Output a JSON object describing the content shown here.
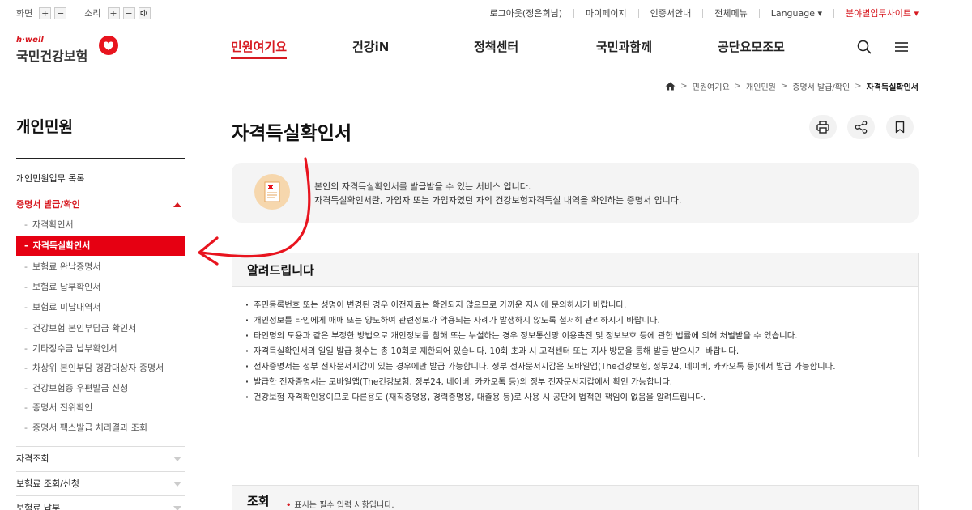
{
  "util": {
    "screen_label": "화면",
    "sound_label": "소리",
    "plus": "+",
    "minus": "−",
    "speaker": "🕩",
    "links": [
      "로그아웃(정은희님)",
      "마이페이지",
      "인증서안내",
      "전체메뉴",
      "Language ▾",
      "분야별업무사이트 ▾"
    ]
  },
  "logo": {
    "sub": "h·well",
    "main": "국민건강보험"
  },
  "nav": {
    "items": [
      "민원여기요",
      "건강iN",
      "정책센터",
      "국민과함께",
      "공단요모조모"
    ],
    "search_icon": "search-icon",
    "menu_icon": "hamburger-icon"
  },
  "breadcrumb": {
    "home_icon": "home-icon",
    "items": [
      "민원여기요",
      "개인민원",
      "증명서 발급/확인"
    ],
    "current": "자격득실확인서"
  },
  "sidebar": {
    "title": "개인민원",
    "items": [
      {
        "label": "개인민원업무 목록"
      },
      {
        "label": "증명서 발급/확인"
      }
    ],
    "sub_items": [
      "자격확인서",
      "자격득실확인서",
      "보험료 완납증명서",
      "보험료 납부확인서",
      "보험료 미납내역서",
      "건강보험 본인부담금 확인서",
      "기타징수금 납부확인서",
      "차상위 본인부담 경감대상자 증명서",
      "건강보험증 우편발급 신청",
      "증명서 진위확인",
      "증명서 팩스발급 처리결과 조회"
    ],
    "lower_items": [
      "자격조회",
      "보험료 조회/신청",
      "보험료 납부"
    ]
  },
  "page": {
    "title": "자격득실확인서",
    "actions": [
      "print-icon",
      "share-icon",
      "bookmark-icon"
    ]
  },
  "intro": {
    "line1": "본인의 자격득실확인서를 발급받을 수 있는 서비스 입니다.",
    "line2": "자격득실확인서란, 가입자 또는 가입자였던 자의 건강보험자격득실 내역을 확인하는 증명서 입니다."
  },
  "notice": {
    "title": "알려드립니다",
    "items": [
      "주민등록번호 또는 성명이 변경된 경우 이전자료는 확인되지 않으므로 가까운 지사에 문의하시기 바랍니다.",
      "개인정보를 타인에게 매매 또는 양도하여 관련정보가 악용되는 사례가 발생하지 않도록 철저히 관리하시기 바랍니다.",
      "타인명의 도용과 같은 부정한 방법으로 개인정보를 침해 또는 누설하는 경우 정보통신망 이용촉진 및 정보보호 등에 관한 법률에 의해 처벌받을 수 있습니다.",
      "자격득실확인서의 일일 발급 횟수는 총 10회로 제한되어 있습니다. 10회 초과 시 고객센터 또는 지사 방문을 통해 발급 받으시기 바랍니다.",
      "전자증명서는 정부 전자문서지갑이 있는 경우에만 발급 가능합니다. 정부 전자문서지갑은 모바일앱(The건강보험, 정부24, 네이버, 카카오톡 등)에서 발급 가능합니다.",
      "발급한 전자증명서는 모바일앱(The건강보험, 정부24, 네이버, 카카오톡 등)의 정부 전자문서지갑에서 확인 가능합니다.",
      "건강보험 자격확인용이므로 다른용도 (재직증명용, 경력증명용, 대출용 등)로 사용 시 공단에 법적인 책임이 없음을 알려드립니다."
    ]
  },
  "lookup": {
    "title": "조회",
    "required_mark": "•",
    "required_note": "표시는 필수 입력 사항입니다."
  },
  "colors": {
    "accent": "#d71a21",
    "active_bg": "#e60012",
    "annotation": "#e8141e"
  }
}
